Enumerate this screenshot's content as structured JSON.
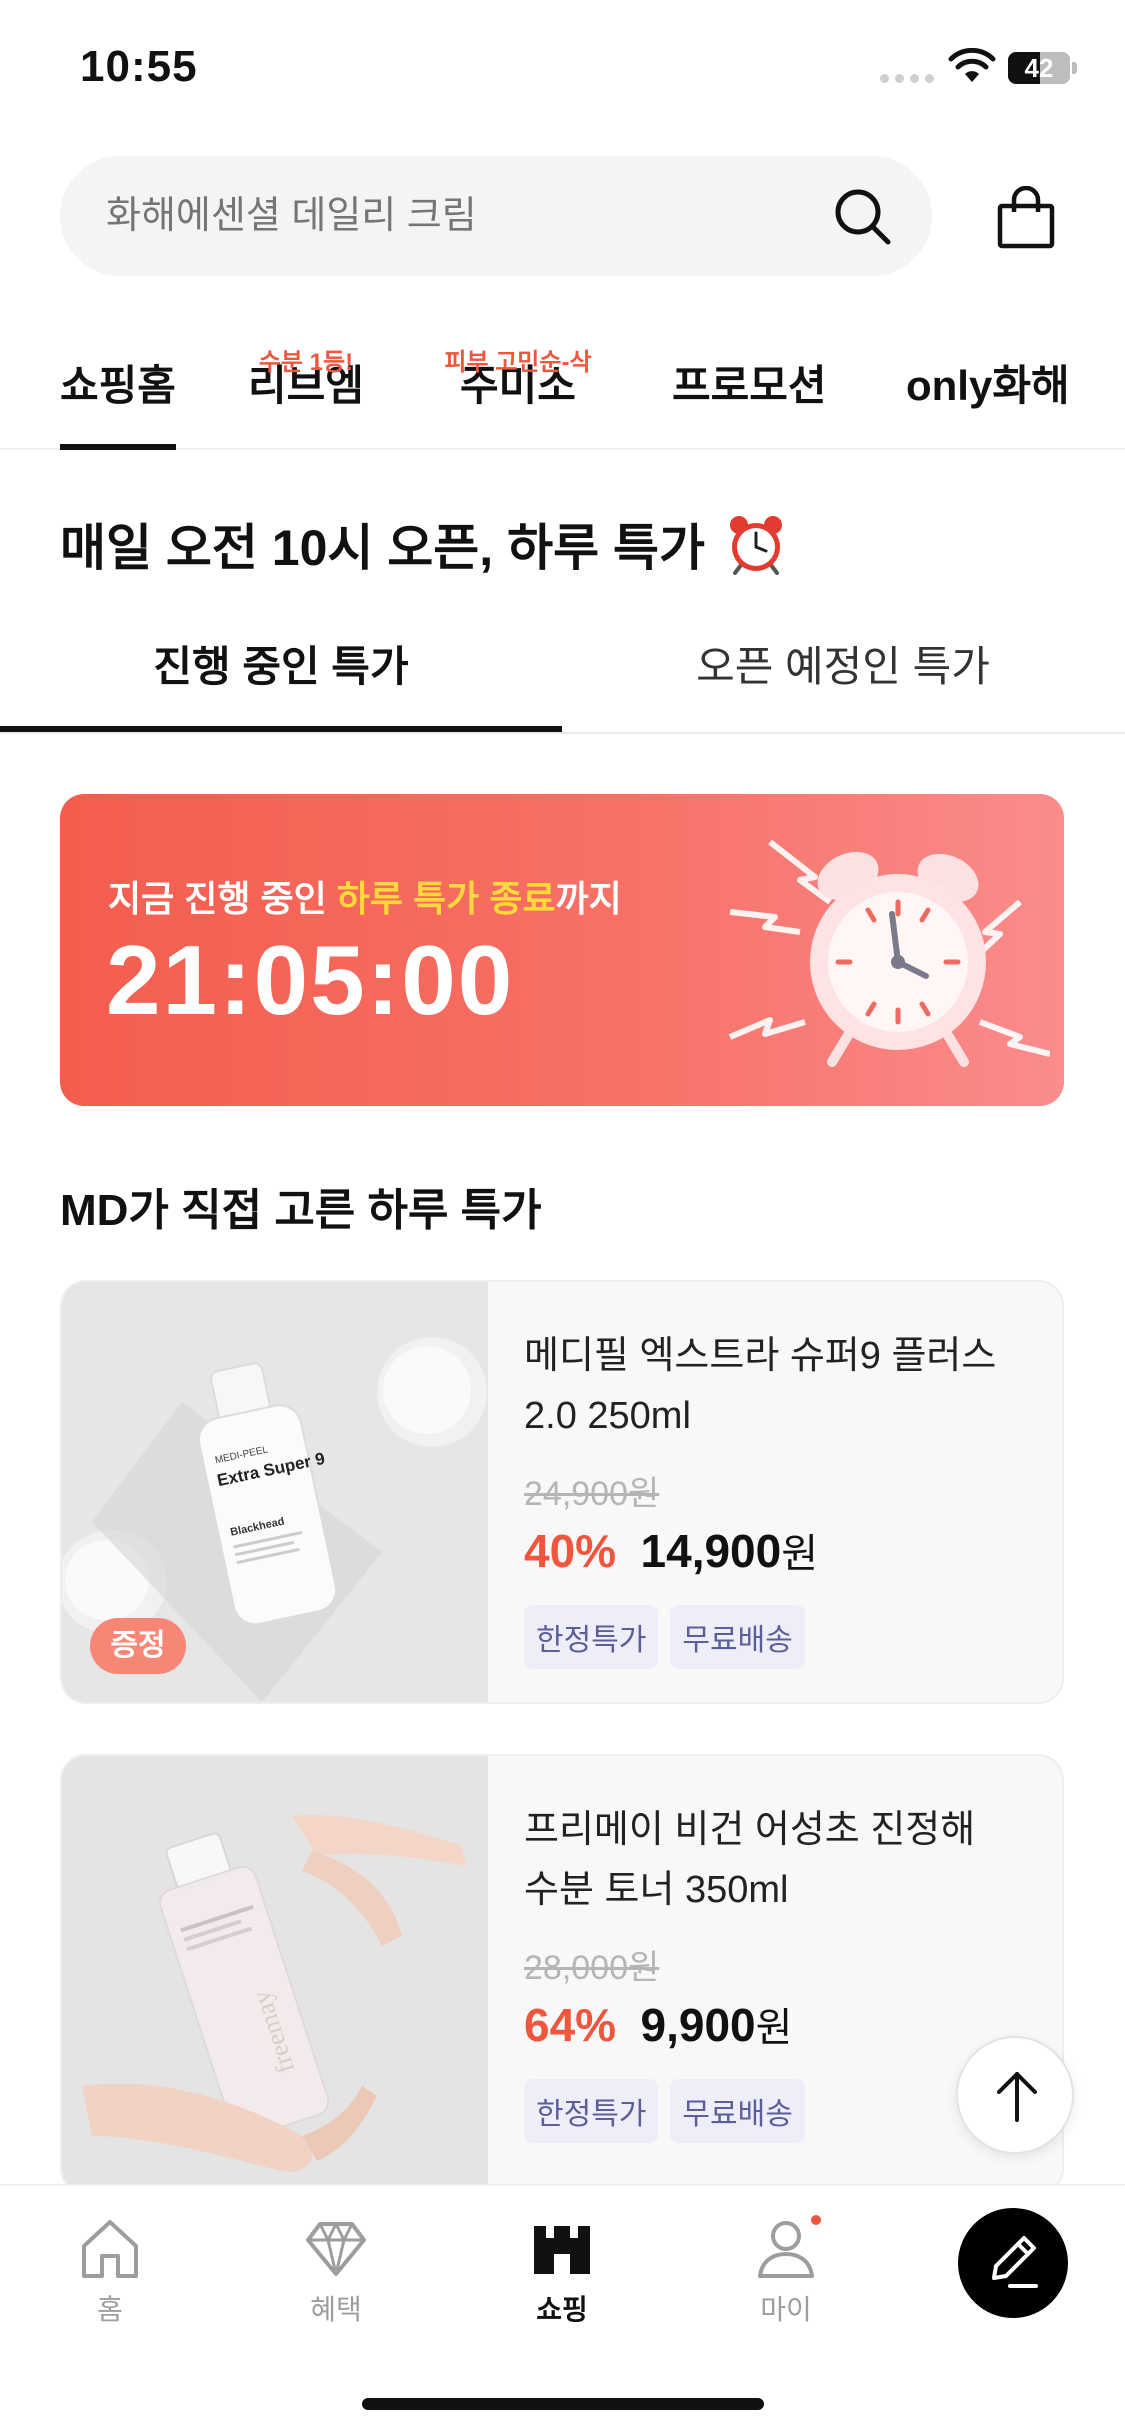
{
  "status_bar": {
    "time": "10:55",
    "battery": "42"
  },
  "search": {
    "placeholder": "화해에센셜 데일리 크림"
  },
  "category_tabs": [
    {
      "label": "쇼핑홈",
      "badge": ""
    },
    {
      "label": "리브엠",
      "badge": "수분 1등!"
    },
    {
      "label": "주미소",
      "badge": "피부 고민순-삭"
    },
    {
      "label": "프로모션",
      "badge": ""
    },
    {
      "label": "only화해",
      "badge": ""
    }
  ],
  "deal": {
    "title": "매일 오전 10시 오픈, 하루 특가",
    "tabs": {
      "active": "진행 중인 특가",
      "inactive": "오픈 예정인 특가"
    }
  },
  "banner": {
    "caption_prefix": "지금 진행 중인 ",
    "caption_highlight": "하루 특가 종료",
    "caption_suffix": "까지",
    "timer": "21:05:00",
    "colors": {
      "start": "#f45d4e",
      "end": "#fa8c8c",
      "highlight": "#ffd93b"
    }
  },
  "md_section": {
    "title": "MD가 직접 고른 하루 특가"
  },
  "products": [
    {
      "name_line1": "메디필 엑스트라 슈퍼9 플러스",
      "name_line2": "2.0 250ml",
      "original_price": "24,900원",
      "discount": "40%",
      "price": "14,900",
      "currency": "원",
      "tags": [
        "한정특가",
        "무료배송"
      ],
      "gift_badge": "증정",
      "bottle_brand": "MEDI-PEEL",
      "bottle_name": "Extra Super 9",
      "bottle_sub": "Blackhead"
    },
    {
      "name_line1": "프리메이 비건 어성초 진정해",
      "name_line2": "수분 토너 350ml",
      "original_price": "28,000원",
      "discount": "64%",
      "price": "9,900",
      "currency": "원",
      "tags": [
        "한정특가",
        "무료배송"
      ],
      "gift_badge": "",
      "bottle_brand": "freemay"
    }
  ],
  "bottom_nav": [
    {
      "label": "홈",
      "icon": "home-icon"
    },
    {
      "label": "혜택",
      "icon": "diamond-icon"
    },
    {
      "label": "쇼핑",
      "icon": "shop-icon"
    },
    {
      "label": "마이",
      "icon": "person-icon"
    }
  ],
  "accent_color": "#f0553d"
}
